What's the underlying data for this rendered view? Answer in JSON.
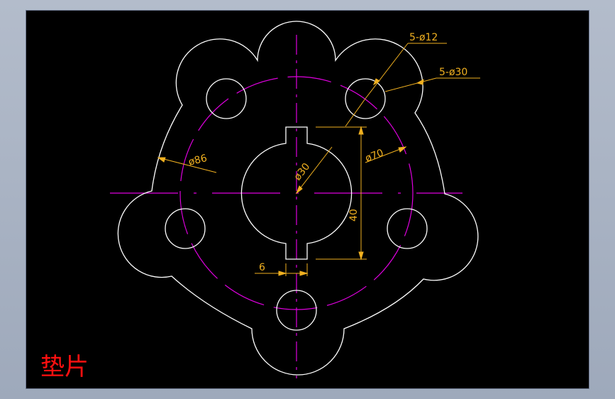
{
  "drawing": {
    "title": "垫片",
    "labels": {
      "hole_count_dia_12": "5-ø12",
      "hole_count_dia_30": "5-ø30",
      "bolt_circle_dia": "ø86",
      "outer_dia": "ø70",
      "bore_dia": "ø30",
      "keyway_height": "40",
      "keyway_width": "6"
    },
    "colors": {
      "background": "#000000",
      "outline": "#ffffff",
      "center_line": "#e000e0",
      "dimension": "#f0b020",
      "title": "#ff1010"
    }
  }
}
